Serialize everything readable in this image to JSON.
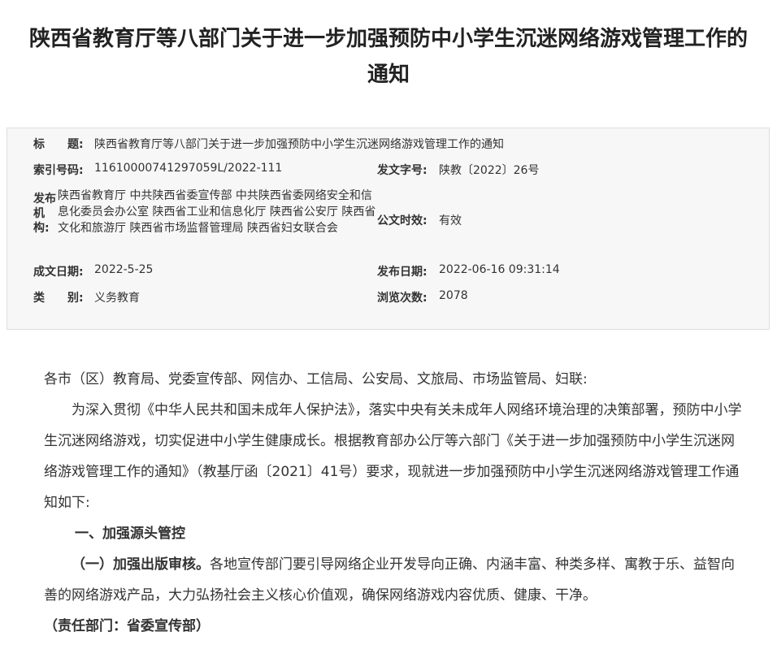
{
  "title": {
    "line1": "陕西省教育厅等八部门关于进一步加强预防中小学生沉迷网络游戏管理工作的",
    "line2": "通知"
  },
  "meta": {
    "subject_label": "标　　题:",
    "subject_value": "陕西省教育厅等八部门关于进一步加强预防中小学生沉迷网络游戏管理工作的通知",
    "index_label": "索引号码:",
    "index_value": "11610000741297059L/2022-111",
    "doc_no_label": "发文字号:",
    "doc_no_value": "陕教〔2022〕26号",
    "org_label": "发布机构:",
    "org_value": "陕西省教育厅 中共陕西省委宣传部 中共陕西省委网络安全和信息化委员会办公室 陕西省工业和信息化厅 陕西省公安厅 陕西省文化和旅游厅 陕西省市场监督管理局 陕西省妇女联合会",
    "validity_label": "公文时效:",
    "validity_value": "有效",
    "date_label": "成文日期:",
    "date_value": "2022-5-25",
    "publish_label": "发布日期:",
    "publish_value": "2022-06-16 09:31:14",
    "category_label": "类　　别:",
    "category_value": "义务教育",
    "views_label": "浏览次数:",
    "views_value": "2078"
  },
  "body": {
    "salutation": "各市（区）教育局、党委宣传部、网信办、工信局、公安局、文旅局、市场监管局、妇联:",
    "para1": "为深入贯彻《中华人民共和国未成年人保护法》，落实中央有关未成年人网络环境治理的决策部署，预防中小学生沉迷网络游戏，切实促进中小学生健康成长。根据教育部办公厅等六部门《关于进一步加强预防中小学生沉迷网络游戏管理工作的通知》（教基厅函〔2021〕41号）要求，现就进一步加强预防中小学生沉迷网络游戏管理工作通知如下:",
    "section1": "一、加强源头管控",
    "sub1_title": "（一）加强出版审核。",
    "sub1_text": "各地宣传部门要引导网络企业开发导向正确、内涵丰富、种类多样、寓教于乐、益智向善的网络游戏产品，大力弘扬社会主义核心价值观，确保网络游戏内容优质、健康、干净。",
    "sub1_resp": "（责任部门：省委宣传部）"
  }
}
